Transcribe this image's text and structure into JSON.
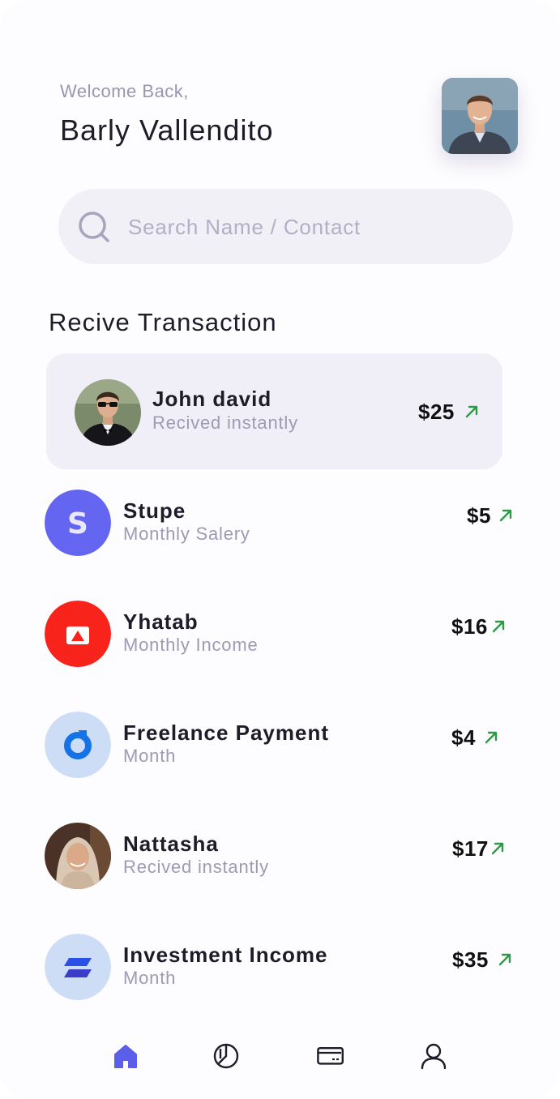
{
  "header": {
    "welcome": "Welcome Back,",
    "username": "Barly Vallendito"
  },
  "search": {
    "placeholder": "Search Name / Contact"
  },
  "section_title": "Recive Transaction",
  "transactions": [
    {
      "name": "John david",
      "subtitle": "Recived instantly",
      "amount": "$25",
      "icon": "photo-avatar-man-suit"
    },
    {
      "name": "Stupe",
      "subtitle": "Monthly Salery",
      "amount": "$5",
      "icon": "stupe-s-logo"
    },
    {
      "name": "Yhatab",
      "subtitle": "Monthly Income",
      "amount": "$16",
      "icon": "yhatab-triangle-logo"
    },
    {
      "name": "Freelance Payment",
      "subtitle": "Month",
      "amount": "$4",
      "icon": "freelance-ring-logo"
    },
    {
      "name": "Nattasha",
      "subtitle": "Recived instantly",
      "amount": "$17",
      "icon": "photo-avatar-woman"
    },
    {
      "name": "Investment Income",
      "subtitle": "Month",
      "amount": "$35",
      "icon": "investment-logo"
    }
  ],
  "nav": [
    "home-icon",
    "chart-icon",
    "card-icon",
    "profile-icon"
  ],
  "colors": {
    "accent": "#5a5ee8",
    "positive": "#2e9a48",
    "stupe": "#6466f1",
    "yhatab": "#f8241b",
    "soft_blue": "#cdddf6"
  }
}
